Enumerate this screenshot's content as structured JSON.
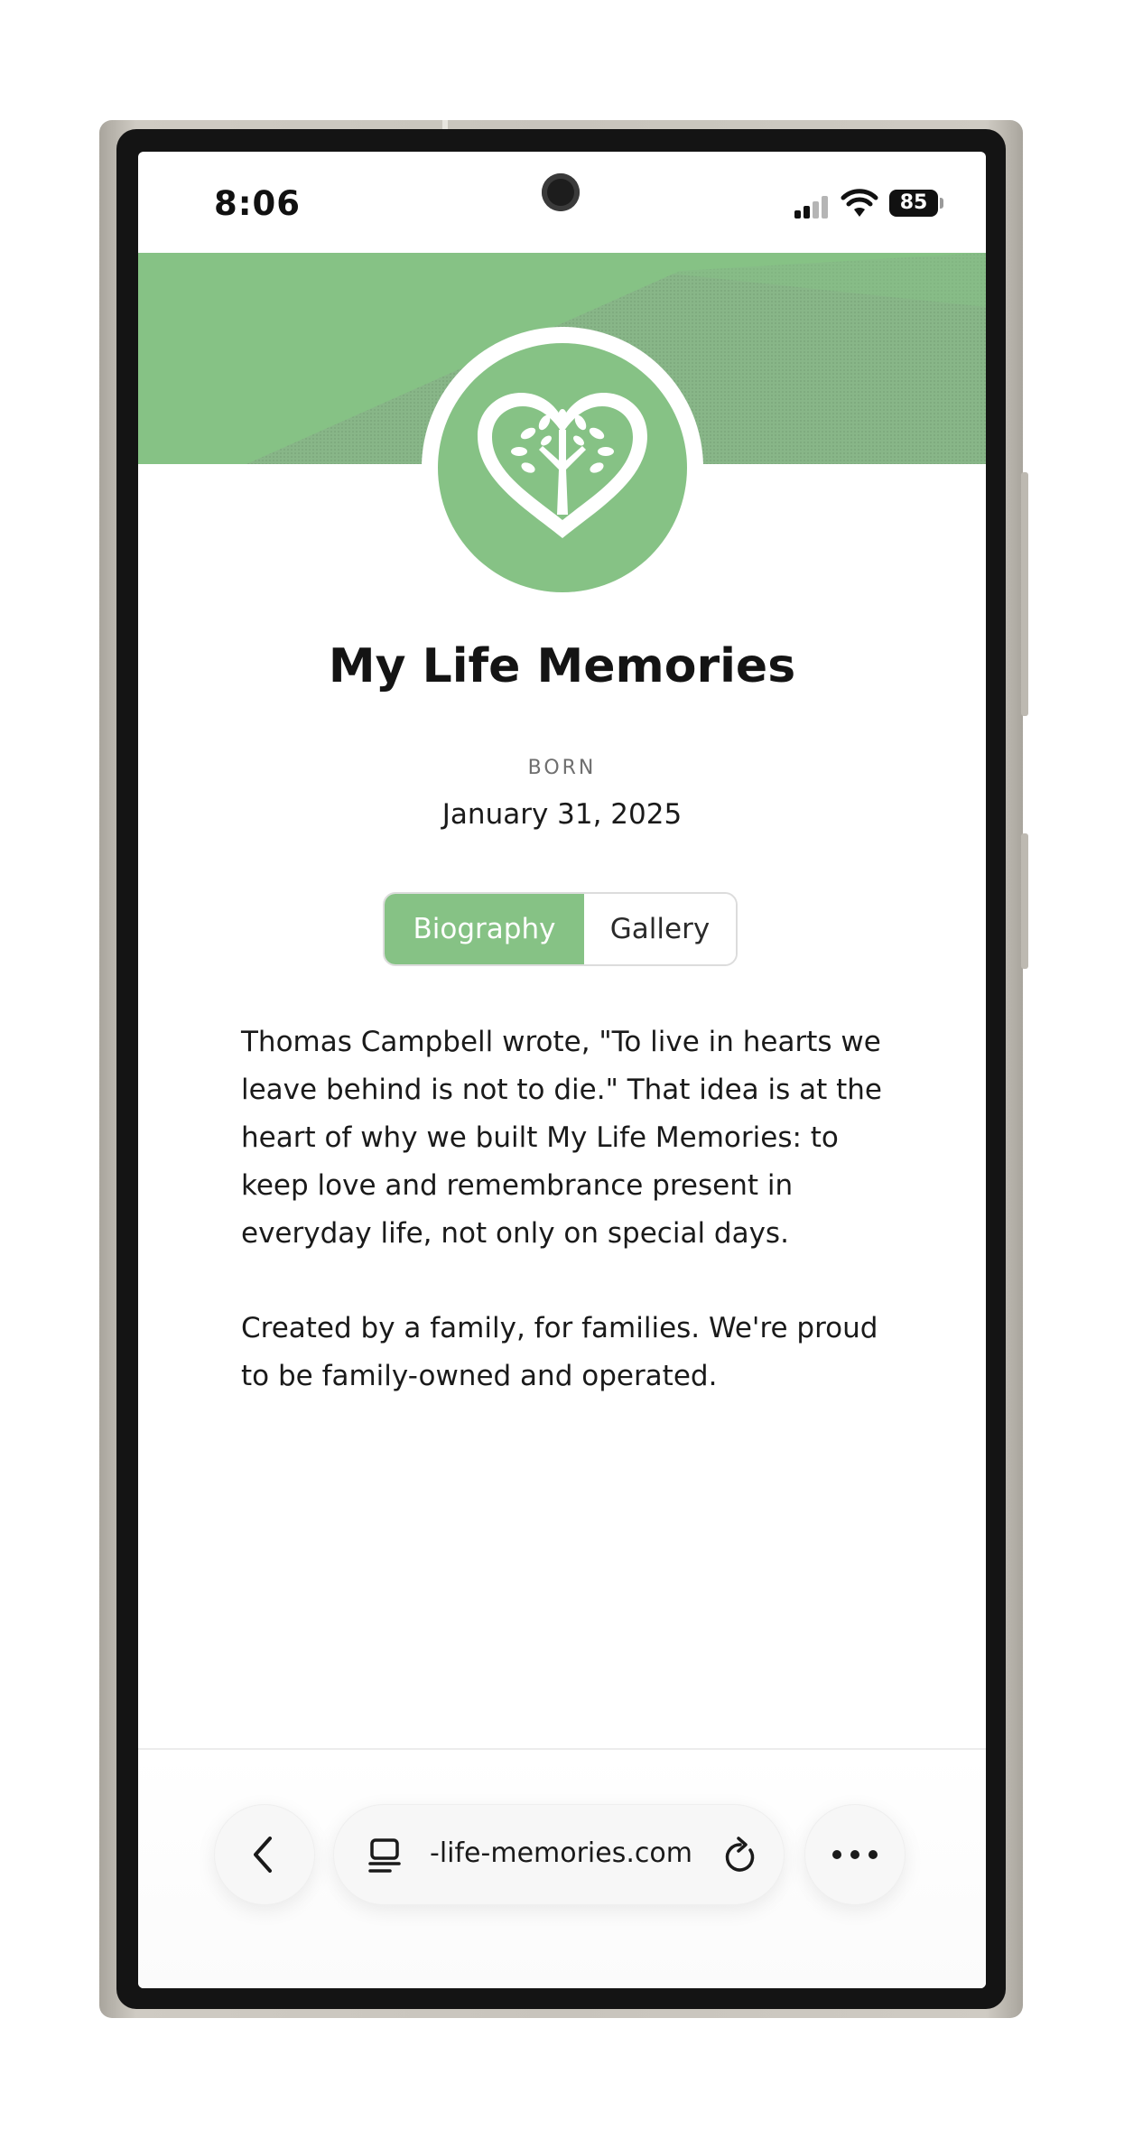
{
  "status_bar": {
    "time": "8:06",
    "battery": "85",
    "icons": [
      "camera-icon",
      "signal-icon",
      "wifi-icon",
      "battery-icon"
    ]
  },
  "profile": {
    "logo_icon": "tree-heart-icon",
    "title": "My Life Memories",
    "born_label": "BORN",
    "born_date": "January 31, 2025"
  },
  "tabs": [
    {
      "label": "Biography",
      "active": true
    },
    {
      "label": "Gallery",
      "active": false
    }
  ],
  "biography": {
    "paragraphs": [
      "Thomas Campbell wrote, \"To live in hearts we leave behind is not to die.\" That idea is at the heart of why we built My Life Memories: to keep love and remembrance present in everyday life, not only on special days.",
      "Created by a family, for families. We're proud to be family-owned and operated."
    ]
  },
  "browser_bar": {
    "url": "-life-memories.com",
    "icons": [
      "back-chevron-icon",
      "tabs-icon",
      "reload-icon",
      "more-icon"
    ]
  },
  "colors": {
    "accent_green": "#86c285",
    "text": "#1a1a1a"
  }
}
